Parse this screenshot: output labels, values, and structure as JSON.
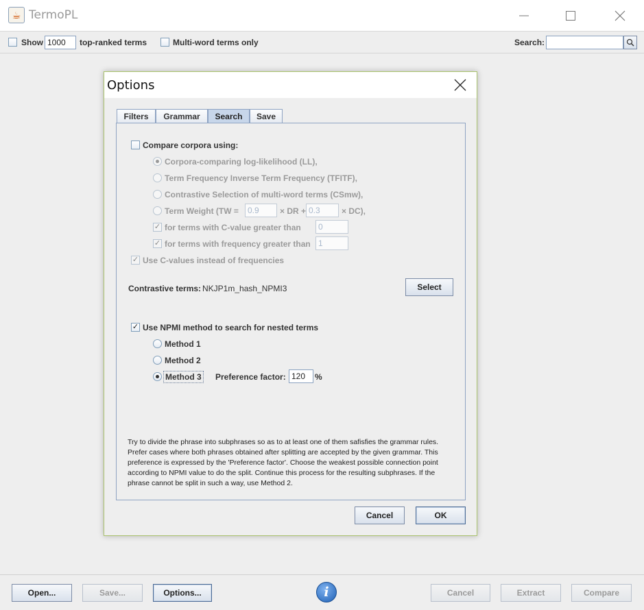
{
  "window": {
    "title": "TermoPL"
  },
  "toolbar": {
    "show_label": "Show",
    "show_count": "1000",
    "top_ranked_label": "top-ranked terms",
    "multiword_label": "Multi-word terms only",
    "search_label": "Search:",
    "search_value": ""
  },
  "dialog": {
    "title": "Options",
    "tabs": [
      "Filters",
      "Grammar",
      "Search",
      "Save"
    ],
    "active_tab": "Search",
    "compare_label": "Compare corpora using:",
    "compare_checked": false,
    "methods": [
      "Corpora-comparing log-likelihood (LL),",
      "Term Frequency Inverse Term Frequency (TFITF),",
      "Contrastive Selection of multi-word terms (CSmw),"
    ],
    "term_weight": {
      "prefix": "Term Weight  (TW =",
      "tw_value": "0.9",
      "mid": "× DR +",
      "dc_value": "0.3",
      "suffix": "× DC),"
    },
    "cvalue_label": "for terms with C-value greater than",
    "cvalue_value": "0",
    "freq_label": "for terms with frequency greater than",
    "freq_value": "1",
    "use_cvalues_label": "Use C-values instead of frequencies",
    "contrastive_label": "Contrastive terms:",
    "contrastive_value": "NKJP1m_hash_NPMI3",
    "select_button": "Select",
    "npmi_label": "Use NPMI method to search for nested terms",
    "npmi_checked": true,
    "npmi_methods": [
      "Method 1",
      "Method 2",
      "Method 3"
    ],
    "npmi_selected": "Method 3",
    "preference_label": "Preference factor:",
    "preference_value": "120",
    "preference_unit": "%",
    "description": "Try to divide the phrase into subphrases so as to at least one of them safisfies the grammar rules. Prefer cases where both phrases obtained after splitting are accepted by the given grammar. This preference is expressed by the 'Preference factor'. Choose the weakest possible connection point according to NPMI value to do the split. Continue this process for the resulting subphrases. If the phrase cannot be split in such a way, use Method 2.",
    "cancel_button": "Cancel",
    "ok_button": "OK"
  },
  "bottom": {
    "open_button": "Open...",
    "save_button": "Save...",
    "options_button": "Options...",
    "info_icon_glyph": "i",
    "cancel_button": "Cancel",
    "extract_button": "Extract",
    "compare_button": "Compare"
  },
  "colors": {
    "tab_active": "#c7d6ea",
    "dialog_border": "#a9c26b",
    "info_blue": "#1d5fb4"
  }
}
